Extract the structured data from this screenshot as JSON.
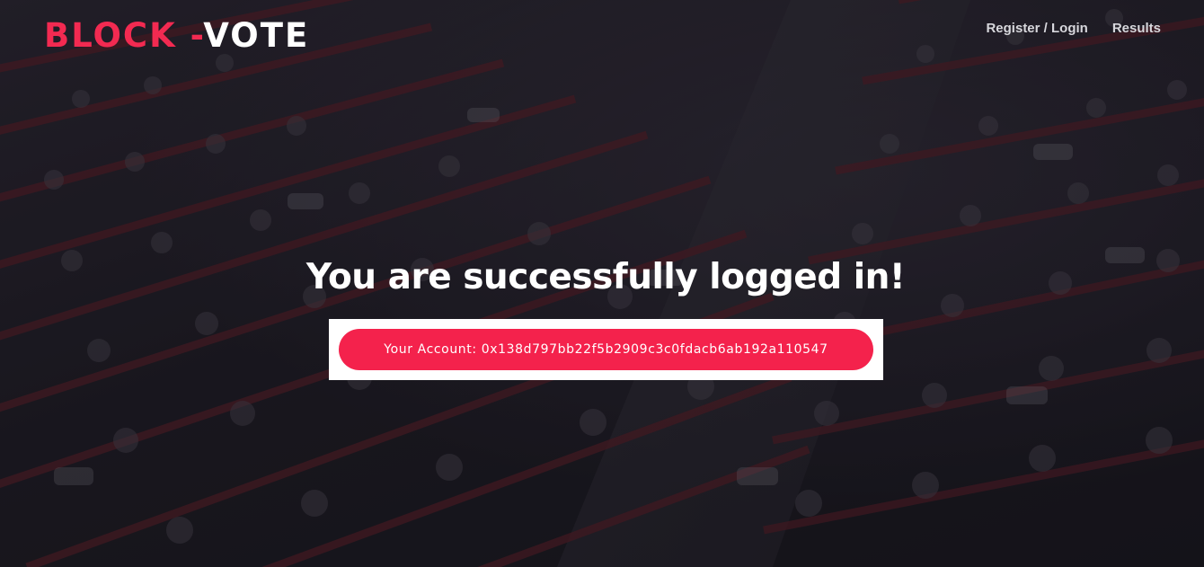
{
  "brand": {
    "logo_part_a": "BLOCK -",
    "logo_part_b": "VOTE",
    "accent_color": "#f22a51"
  },
  "nav": {
    "items": [
      {
        "label": "Register / Login"
      },
      {
        "label": "Results"
      }
    ]
  },
  "hero": {
    "headline": "You are successfully logged in!",
    "account_text": "Your Account: 0x138d797bb22f5b2909c3c0fdacb6ab192a110547"
  },
  "background": {
    "subject": "auditorium-audience-photo"
  }
}
